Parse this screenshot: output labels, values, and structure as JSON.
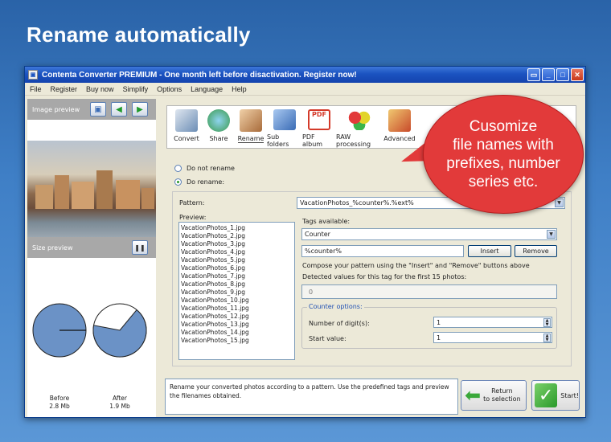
{
  "headline": "Rename automatically",
  "window": {
    "title": "Contenta Converter PREMIUM  - One month left before disactivation. Register now!"
  },
  "menu": [
    "File",
    "Register",
    "Buy now",
    "Simplify",
    "Options",
    "Language",
    "Help"
  ],
  "left_panel": {
    "image_preview_label": "Image preview",
    "size_preview_label": "Size preview",
    "pause_icon": "pause-icon",
    "before": {
      "label": "Before",
      "size": "2.8 Mb"
    },
    "after": {
      "label": "After",
      "size": "1.9 Mb",
      "fraction": 0.67
    }
  },
  "toolbar": [
    {
      "label": "Convert",
      "icon": "convert-icon",
      "color": "#6b8db5"
    },
    {
      "label": "Share",
      "icon": "share-icon",
      "color": "#3a9a4a"
    },
    {
      "label": "Rename",
      "icon": "rename-icon",
      "color": "#a86b3a"
    },
    {
      "label": "Sub folders",
      "icon": "folders-icon",
      "color": "#3a6bb5"
    },
    {
      "label": "PDF album",
      "icon": "pdf-icon",
      "color": "#d43a2a"
    },
    {
      "label": "RAW processing",
      "icon": "raw-icon",
      "color": "#e2b42a"
    },
    {
      "label": "Advanced",
      "icon": "advanced-icon",
      "color": "#c84a2a"
    }
  ],
  "rename": {
    "do_not_rename": "Do not rename",
    "do_rename": "Do rename:",
    "pattern_label": "Pattern:",
    "pattern_value": "VacationPhotos_%counter%.%ext%",
    "preview_label": "Preview:",
    "preview_files": [
      "VacationPhotos_1.jpg",
      "VacationPhotos_2.jpg",
      "VacationPhotos_3.jpg",
      "VacationPhotos_4.jpg",
      "VacationPhotos_5.jpg",
      "VacationPhotos_6.jpg",
      "VacationPhotos_7.jpg",
      "VacationPhotos_8.jpg",
      "VacationPhotos_9.jpg",
      "VacationPhotos_10.jpg",
      "VacationPhotos_11.jpg",
      "VacationPhotos_12.jpg",
      "VacationPhotos_13.jpg",
      "VacationPhotos_14.jpg",
      "VacationPhotos_15.jpg"
    ],
    "tags_label": "Tags available:",
    "tag_selected": "Counter",
    "tag_code": "%counter%",
    "insert_btn": "Insert",
    "remove_btn": "Remove",
    "compose_hint": "Compose your pattern using the \"Insert\" and \"Remove\" buttons above",
    "detected_label": "Detected values for this tag for the first 15 photos:",
    "detected_value": "0",
    "counter_options": "Counter options:",
    "digits_label": "Number of digit(s):",
    "digits_value": "1",
    "start_label": "Start value:",
    "start_value": "1"
  },
  "bottom": {
    "description": "Rename your converted photos according to a pattern. Use the predefined tags and preview the filenames obtained.",
    "return_line1": "Return",
    "return_line2": "to selection",
    "start": "Start!"
  },
  "callout": {
    "lines": [
      "Cusomize",
      "file names with",
      "prefixes, number",
      "series etc."
    ],
    "color": "#e23a3a"
  }
}
